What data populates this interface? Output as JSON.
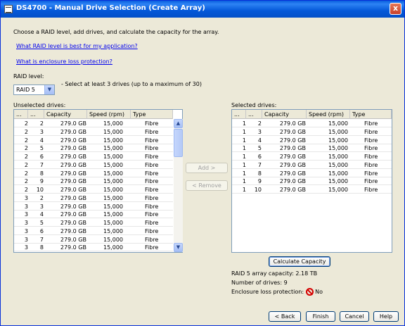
{
  "window": {
    "title": "DS4700 - Manual Drive Selection (Create Array)",
    "close_label": "x"
  },
  "intro": "Choose a RAID level, add drives, and calculate the capacity for the array.",
  "links": [
    "What RAID level is best for my application?",
    "What is enclosure loss protection?"
  ],
  "raid": {
    "label": "RAID level:",
    "value": "RAID 5",
    "hint": "- Select at least 3 drives (up to a maximum of 30)"
  },
  "columns": [
    "...",
    "...",
    "Capacity",
    "Speed (rpm)",
    "Type"
  ],
  "unselected": {
    "label": "Unselected drives:",
    "rows": [
      [
        "2",
        "2",
        "279.0 GB",
        "15,000",
        "Fibre"
      ],
      [
        "2",
        "3",
        "279.0 GB",
        "15,000",
        "Fibre"
      ],
      [
        "2",
        "4",
        "279.0 GB",
        "15,000",
        "Fibre"
      ],
      [
        "2",
        "5",
        "279.0 GB",
        "15,000",
        "Fibre"
      ],
      [
        "2",
        "6",
        "279.0 GB",
        "15,000",
        "Fibre"
      ],
      [
        "2",
        "7",
        "279.0 GB",
        "15,000",
        "Fibre"
      ],
      [
        "2",
        "8",
        "279.0 GB",
        "15,000",
        "Fibre"
      ],
      [
        "2",
        "9",
        "279.0 GB",
        "15,000",
        "Fibre"
      ],
      [
        "2",
        "10",
        "279.0 GB",
        "15,000",
        "Fibre"
      ],
      [
        "3",
        "2",
        "279.0 GB",
        "15,000",
        "Fibre"
      ],
      [
        "3",
        "3",
        "279.0 GB",
        "15,000",
        "Fibre"
      ],
      [
        "3",
        "4",
        "279.0 GB",
        "15,000",
        "Fibre"
      ],
      [
        "3",
        "5",
        "279.0 GB",
        "15,000",
        "Fibre"
      ],
      [
        "3",
        "6",
        "279.0 GB",
        "15,000",
        "Fibre"
      ],
      [
        "3",
        "7",
        "279.0 GB",
        "15,000",
        "Fibre"
      ],
      [
        "3",
        "8",
        "279.0 GB",
        "15,000",
        "Fibre"
      ]
    ]
  },
  "selected": {
    "label": "Selected drives:",
    "rows": [
      [
        "1",
        "2",
        "279.0 GB",
        "15,000",
        "Fibre"
      ],
      [
        "1",
        "3",
        "279.0 GB",
        "15,000",
        "Fibre"
      ],
      [
        "1",
        "4",
        "279.0 GB",
        "15,000",
        "Fibre"
      ],
      [
        "1",
        "5",
        "279.0 GB",
        "15,000",
        "Fibre"
      ],
      [
        "1",
        "6",
        "279.0 GB",
        "15,000",
        "Fibre"
      ],
      [
        "1",
        "7",
        "279.0 GB",
        "15,000",
        "Fibre"
      ],
      [
        "1",
        "8",
        "279.0 GB",
        "15,000",
        "Fibre"
      ],
      [
        "1",
        "9",
        "279.0 GB",
        "15,000",
        "Fibre"
      ],
      [
        "1",
        "10",
        "279.0 GB",
        "15,000",
        "Fibre"
      ]
    ]
  },
  "buttons": {
    "add": "Add >",
    "remove": "< Remove",
    "calculate": "Calculate Capacity",
    "back": "< Back",
    "finish": "Finish",
    "cancel": "Cancel",
    "help": "Help"
  },
  "summary": {
    "capacity": "RAID 5 array capacity: 2.18 TB",
    "drives": "Number of drives: 9",
    "protection_label": "Enclosure loss protection:",
    "protection_value": "No"
  },
  "icons": {
    "scroll_up": "▲",
    "scroll_down": "▼",
    "dropdown": "▼"
  }
}
